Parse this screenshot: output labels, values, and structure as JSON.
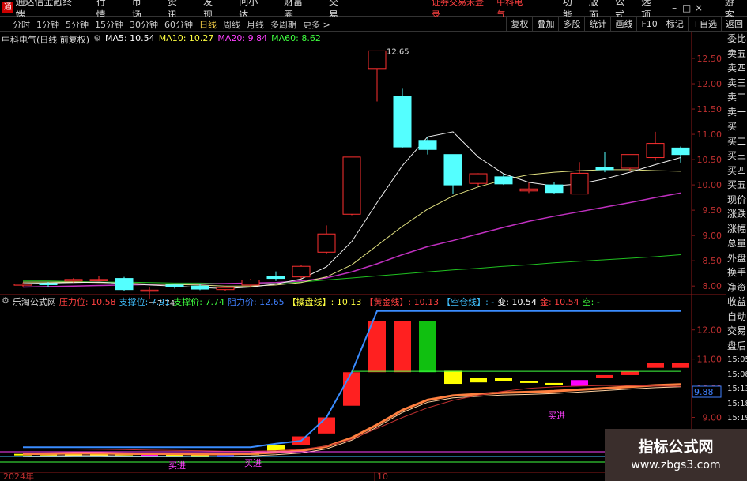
{
  "menubar": {
    "logo_char": "通",
    "app_title": "通达信金融终端",
    "items": [
      "行情",
      "市场",
      "资讯",
      "发现",
      "问小达",
      "财富圈",
      "交易"
    ],
    "login_status": "证券交易未登录",
    "stock": "中科电气",
    "right_items": [
      "功能",
      "版面",
      "公式",
      "选项"
    ],
    "window_buttons": [
      "–",
      "□",
      "×"
    ],
    "guest": "游客"
  },
  "toolbar": {
    "periods": [
      "分时",
      "1分钟",
      "5分钟",
      "15分钟",
      "30分钟",
      "60分钟",
      "日线",
      "周线",
      "月线",
      "多周期",
      "更多 >"
    ],
    "active_period": "日线",
    "right_buttons": [
      "复权",
      "叠加",
      "多股",
      "统计",
      "画线",
      "F10",
      "标记",
      "+自选",
      "返回"
    ]
  },
  "main_legend": {
    "stock_label": "中科电气(日线 前复权)",
    "ma5": "MA5: 10.54",
    "ma10": "MA10: 10.27",
    "ma20": "MA20: 9.84",
    "ma60": "MA60: 8.62"
  },
  "indicator_legend": {
    "name": "乐淘公式网",
    "items": [
      {
        "text": "压力位: 10.58",
        "color": "#ff4040"
      },
      {
        "text": "支撑位: 7.91",
        "color": "#40c0ff"
      },
      {
        "text": "支撑价: 7.74",
        "color": "#40ff40"
      },
      {
        "text": "阻力价: 12.65",
        "color": "#4080ff"
      },
      {
        "text": "【操盘线】: 10.13",
        "color": "#ffff40"
      },
      {
        "text": "【黄金线】: 10.13",
        "color": "#ff4040"
      },
      {
        "text": "【空仓线】: -",
        "color": "#40c0ff"
      },
      {
        "text": "变: 10.54",
        "color": "#ffffff"
      },
      {
        "text": "金: 10.54",
        "color": "#ff4040"
      },
      {
        "text": "空: -",
        "color": "#40ff40"
      }
    ]
  },
  "right_panel": {
    "items": [
      "委比",
      "卖五",
      "卖四",
      "卖三",
      "卖二",
      "卖一",
      "买一",
      "买二",
      "买三",
      "买四",
      "买五",
      "现价",
      "涨跌",
      "涨幅",
      "总量",
      "外盘",
      "换手",
      "净资",
      "收益",
      "自动",
      "交易",
      "盘后",
      "15:05",
      "15:08",
      "15:13",
      "15:18",
      "15:19",
      "15:19"
    ]
  },
  "axes": {
    "main_y_ticks": [
      "12.50",
      "12.00",
      "11.50",
      "11.00",
      "10.50",
      "10.00",
      "9.50",
      "9.00",
      "8.50",
      "8.00"
    ],
    "ind_y_ticks": [
      "12.00",
      "11.00",
      "10.00",
      "9.00"
    ],
    "ind_current": "9.88",
    "x_labels": [
      "2024年",
      "10"
    ]
  },
  "annotations": {
    "high": "12.65",
    "low": "7.74",
    "buy1": "买进",
    "buy2": "买进",
    "buy3": "买进"
  },
  "watermark": {
    "title": "指标公式网",
    "url": "www.zbgs3.com"
  },
  "chart_data": [
    {
      "type": "candlestick",
      "ylim": [
        7.8,
        12.75
      ],
      "candles": [
        {
          "o": 8.02,
          "c": 8.04,
          "h": 8.07,
          "l": 7.99
        },
        {
          "o": 8.05,
          "c": 8.04,
          "h": 8.08,
          "l": 7.98
        },
        {
          "o": 8.1,
          "c": 8.13,
          "h": 8.16,
          "l": 8.07
        },
        {
          "o": 8.12,
          "c": 8.13,
          "h": 8.2,
          "l": 8.1
        },
        {
          "o": 8.15,
          "c": 7.93,
          "h": 8.18,
          "l": 7.91
        },
        {
          "o": 7.92,
          "c": 7.92,
          "h": 7.98,
          "l": 7.74
        },
        {
          "o": 8.02,
          "c": 7.98,
          "h": 8.05,
          "l": 7.95
        },
        {
          "o": 8.0,
          "c": 7.94,
          "h": 8.04,
          "l": 7.92
        },
        {
          "o": 7.93,
          "c": 7.97,
          "h": 8.0,
          "l": 7.9
        },
        {
          "o": 8.02,
          "c": 8.12,
          "h": 8.14,
          "l": 7.97
        },
        {
          "o": 8.19,
          "c": 8.15,
          "h": 8.29,
          "l": 8.1
        },
        {
          "o": 8.18,
          "c": 8.39,
          "h": 8.42,
          "l": 8.15
        },
        {
          "o": 8.67,
          "c": 9.03,
          "h": 9.2,
          "l": 8.64
        },
        {
          "o": 9.42,
          "c": 10.55,
          "h": 10.55,
          "l": 9.4
        },
        {
          "o": 12.3,
          "c": 12.65,
          "h": 12.65,
          "l": 11.65
        },
        {
          "o": 11.75,
          "c": 10.75,
          "h": 11.9,
          "l": 10.72
        },
        {
          "o": 10.88,
          "c": 10.7,
          "h": 10.95,
          "l": 10.6
        },
        {
          "o": 10.6,
          "c": 10.0,
          "h": 10.6,
          "l": 9.82
        },
        {
          "o": 10.03,
          "c": 10.22,
          "h": 10.23,
          "l": 9.98
        },
        {
          "o": 10.16,
          "c": 10.02,
          "h": 10.22,
          "l": 10.0
        },
        {
          "o": 9.88,
          "c": 9.92,
          "h": 10.04,
          "l": 9.84
        },
        {
          "o": 10.0,
          "c": 9.85,
          "h": 10.05,
          "l": 9.82
        },
        {
          "o": 9.82,
          "c": 10.23,
          "h": 10.45,
          "l": 9.82
        },
        {
          "o": 10.35,
          "c": 10.3,
          "h": 10.65,
          "l": 10.25
        },
        {
          "o": 10.33,
          "c": 10.6,
          "h": 10.6,
          "l": 10.28
        },
        {
          "o": 10.54,
          "c": 10.82,
          "h": 11.05,
          "l": 10.48
        },
        {
          "o": 10.73,
          "c": 10.6,
          "h": 10.76,
          "l": 10.44
        }
      ],
      "ma5": [
        8.05,
        8.06,
        8.07,
        8.08,
        8.05,
        8.02,
        8.0,
        7.97,
        7.95,
        7.98,
        8.04,
        8.14,
        8.38,
        8.88,
        9.65,
        10.38,
        10.95,
        11.05,
        10.55,
        10.22,
        10.05,
        9.98,
        10.02,
        10.12,
        10.25,
        10.4,
        10.54
      ],
      "ma10": [
        8.08,
        8.08,
        8.08,
        8.07,
        8.06,
        8.04,
        8.03,
        8.02,
        8.0,
        8.0,
        8.02,
        8.07,
        8.18,
        8.42,
        8.8,
        9.18,
        9.52,
        9.78,
        9.96,
        10.1,
        10.2,
        10.25,
        10.28,
        10.3,
        10.3,
        10.28,
        10.27
      ],
      "ma20": [
        7.98,
        7.99,
        8.0,
        8.01,
        8.02,
        8.03,
        8.04,
        8.04,
        8.05,
        8.06,
        8.07,
        8.1,
        8.16,
        8.28,
        8.44,
        8.62,
        8.78,
        8.9,
        9.03,
        9.16,
        9.28,
        9.38,
        9.47,
        9.56,
        9.65,
        9.75,
        9.84
      ],
      "ma60": [
        8.1,
        8.1,
        8.09,
        8.08,
        8.08,
        8.07,
        8.06,
        8.06,
        8.05,
        8.05,
        8.06,
        8.08,
        8.12,
        8.16,
        8.2,
        8.24,
        8.28,
        8.32,
        8.35,
        8.39,
        8.42,
        8.46,
        8.49,
        8.52,
        8.55,
        8.58,
        8.62
      ]
    },
    {
      "type": "bar",
      "ylim": [
        7.2,
        12.75
      ],
      "resistance": [
        7.98,
        7.98,
        7.98,
        7.98,
        7.98,
        7.98,
        7.98,
        7.98,
        7.98,
        7.98,
        8.1,
        8.2,
        9.0,
        10.55,
        12.65,
        12.65,
        12.65,
        12.65,
        12.65,
        12.65,
        12.65,
        12.65,
        12.65,
        12.65,
        12.65,
        12.65,
        12.65
      ],
      "pressure": [
        null,
        null,
        null,
        null,
        null,
        null,
        null,
        null,
        null,
        null,
        null,
        null,
        null,
        10.58,
        10.58,
        10.58,
        10.58,
        10.58,
        10.58,
        10.58,
        10.58,
        10.58,
        10.58,
        10.58,
        10.58,
        10.58,
        10.58
      ],
      "gold": [
        7.75,
        7.76,
        7.77,
        7.77,
        7.76,
        7.75,
        7.75,
        7.74,
        7.74,
        7.76,
        7.8,
        7.86,
        8.0,
        8.3,
        8.75,
        9.25,
        9.6,
        9.75,
        9.8,
        9.85,
        9.87,
        9.9,
        9.95,
        10.0,
        10.05,
        10.1,
        10.13
      ],
      "bars": [
        {
          "top": 7.75,
          "bottom": 7.7,
          "color": "#ffff00"
        },
        {
          "top": 7.75,
          "bottom": 7.7,
          "color": "#ffff00"
        },
        {
          "top": 7.76,
          "bottom": 7.7,
          "color": "#ffff00"
        },
        {
          "top": 7.76,
          "bottom": 7.7,
          "color": "#ffff00"
        },
        {
          "top": 7.76,
          "bottom": 7.7,
          "color": "#ffff00"
        },
        {
          "top": 7.72,
          "bottom": 7.67,
          "color": "#ff00ff"
        },
        {
          "top": 7.72,
          "bottom": 7.67,
          "color": "#ffff00"
        },
        {
          "top": 7.72,
          "bottom": 7.67,
          "color": "#ffff00"
        },
        {
          "top": 7.78,
          "bottom": 7.65,
          "color": "#2020ff"
        },
        {
          "top": 7.78,
          "bottom": 7.72,
          "color": "#ffff00"
        },
        {
          "top": 8.05,
          "bottom": 7.8,
          "color": "#ffff00"
        },
        {
          "top": 8.35,
          "bottom": 8.05,
          "color": "#ff2020"
        },
        {
          "top": 9.0,
          "bottom": 8.45,
          "color": "#ff2020"
        },
        {
          "top": 10.55,
          "bottom": 9.4,
          "color": "#ff2020"
        },
        {
          "top": 12.3,
          "bottom": 10.55,
          "color": "#ff2020"
        },
        {
          "top": 12.3,
          "bottom": 10.55,
          "color": "#ff2020"
        },
        {
          "top": 12.3,
          "bottom": 10.55,
          "color": "#10c010"
        },
        {
          "top": 10.6,
          "bottom": 10.15,
          "color": "#ffff00"
        },
        {
          "top": 10.35,
          "bottom": 10.2,
          "color": "#ffff00"
        },
        {
          "top": 10.35,
          "bottom": 10.25,
          "color": "#ffff00"
        },
        {
          "top": 10.25,
          "bottom": 10.18,
          "color": "#ffff00"
        },
        {
          "top": 10.18,
          "bottom": 10.12,
          "color": "#ffff00"
        },
        {
          "top": 10.28,
          "bottom": 10.08,
          "color": "#ff00ff"
        },
        {
          "top": 10.45,
          "bottom": 10.35,
          "color": "#ff2020"
        },
        {
          "top": 10.58,
          "bottom": 10.45,
          "color": "#ff2020"
        },
        {
          "top": 10.88,
          "bottom": 10.7,
          "color": "#ff2020"
        },
        {
          "top": 10.88,
          "bottom": 10.7,
          "color": "#ff2020"
        }
      ]
    }
  ]
}
